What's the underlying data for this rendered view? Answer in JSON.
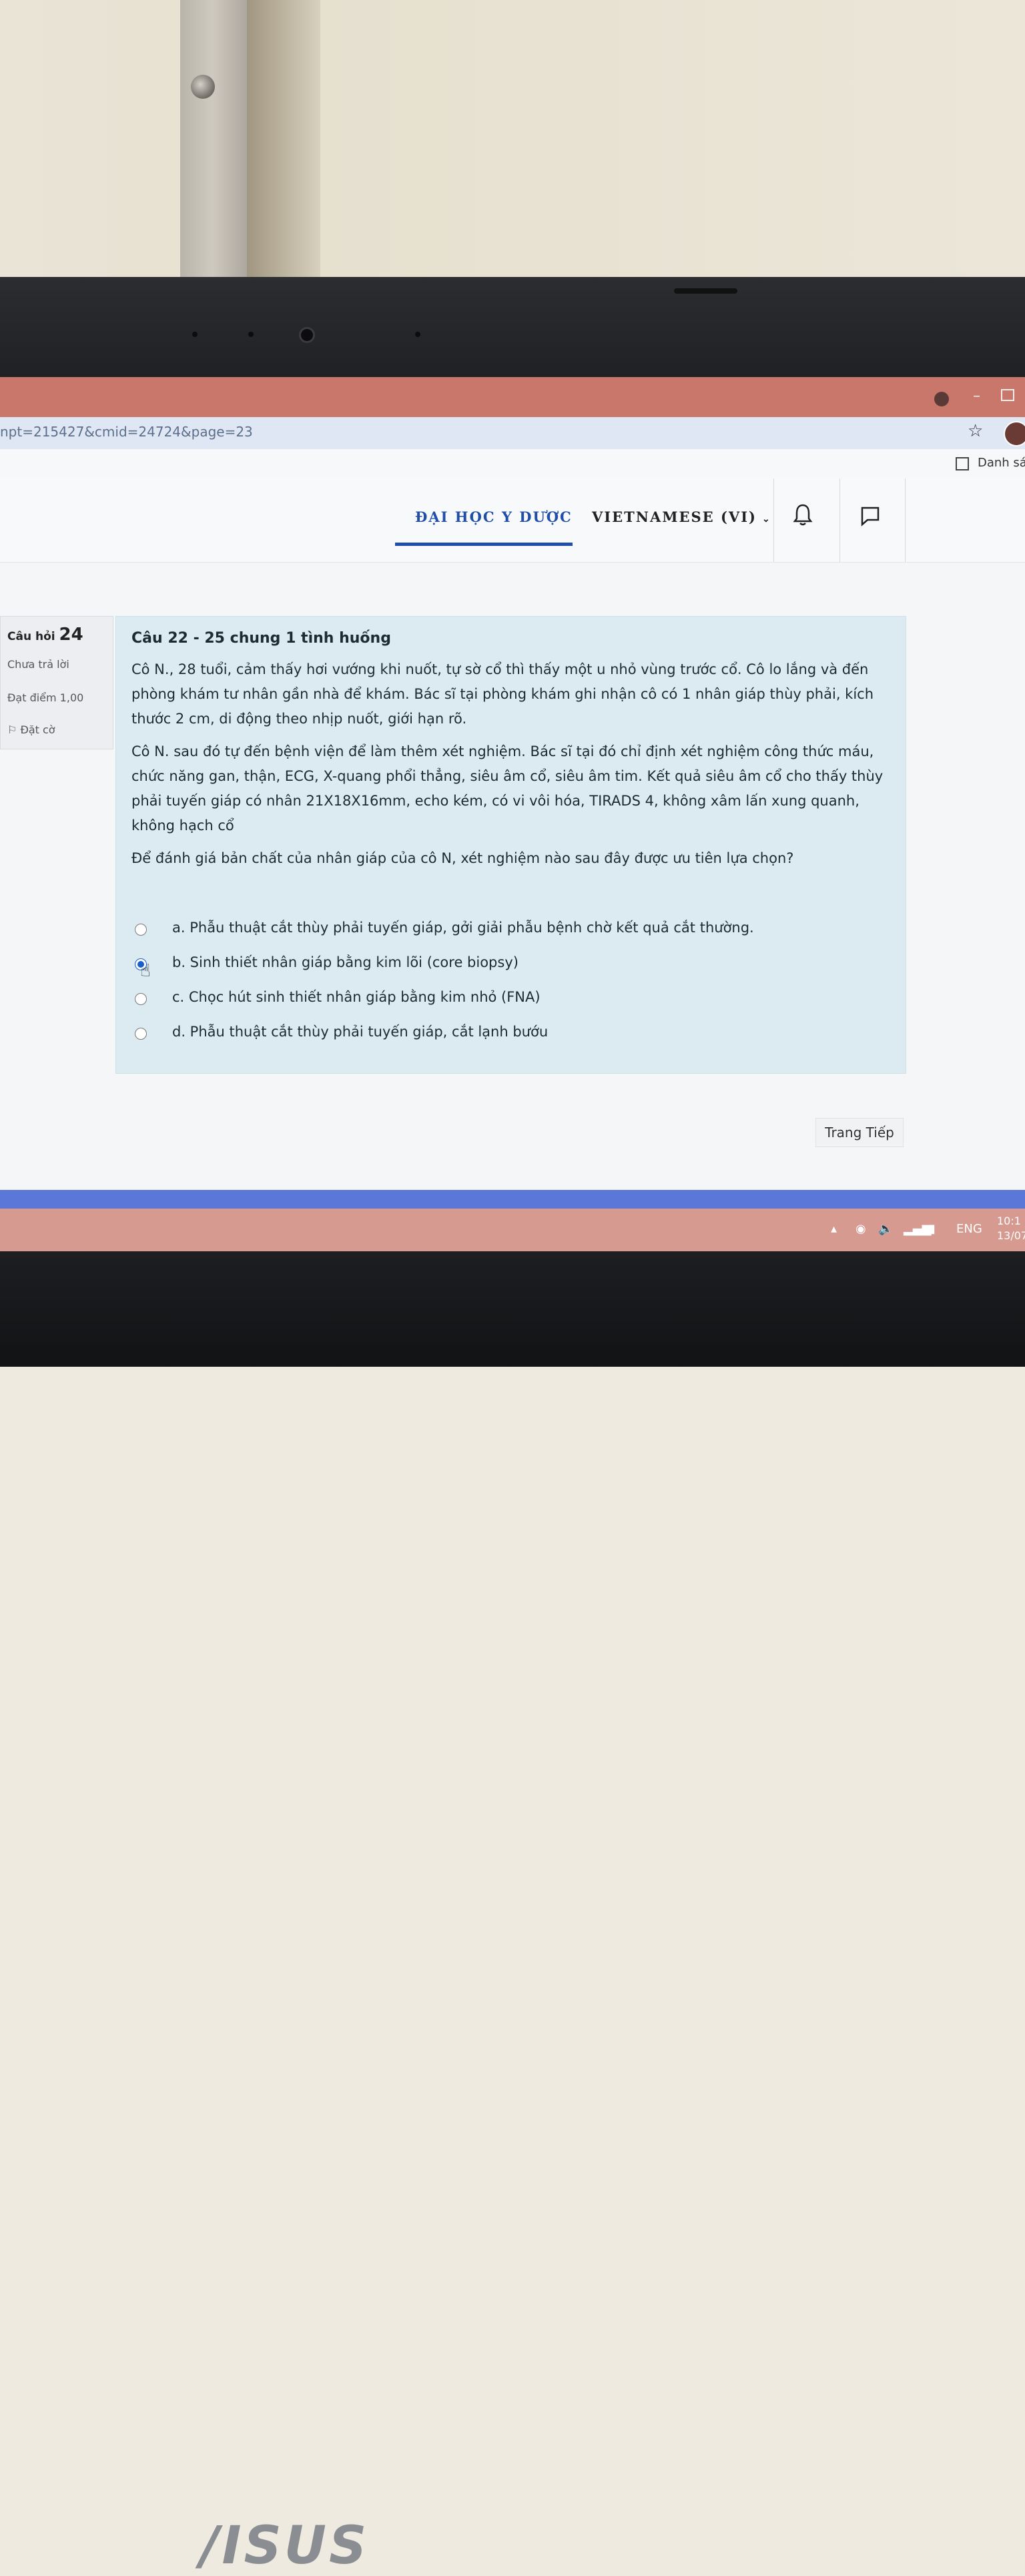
{
  "browser": {
    "url": "npt=215427&cmid=24724&page=23",
    "bookmark_label": "Danh sác"
  },
  "navbar": {
    "university": "ĐẠI HỌC Y DƯỢC",
    "language": "VIETNAMESE (VI)"
  },
  "question_info": {
    "label": "Câu hỏi",
    "number": "24",
    "status": "Chưa trả lời",
    "mark": "Đạt điểm 1,00",
    "flag": "Đặt cờ"
  },
  "question": {
    "heading": "Câu 22 - 25 chung 1 tình huống",
    "paragraph1": "Cô N., 28 tuổi, cảm thấy hơi vướng khi nuốt, tự sờ cổ thì thấy một u nhỏ vùng trước cổ. Cô lo lắng và đến phòng khám tư nhân gần nhà để khám. Bác sĩ tại phòng khám ghi nhận cô có 1 nhân giáp thùy phải, kích thước 2 cm, di động theo nhịp nuốt, giới hạn rõ.",
    "paragraph2": "Cô N. sau đó tự đến bệnh viện để làm thêm xét nghiệm. Bác sĩ tại đó chỉ định xét nghiệm công thức máu, chức năng gan, thận, ECG, X-quang phổi thẳng, siêu âm cổ, siêu âm tim. Kết quả siêu âm cổ cho thấy thùy phải tuyến giáp có nhân 21X18X16mm, echo kém, có vi vôi hóa, TIRADS 4, không xâm lấn xung quanh, không hạch cổ",
    "prompt": "Để đánh giá bản chất của nhân giáp của cô N, xét nghiệm nào sau đây được ưu tiên lựa chọn?",
    "answers": [
      {
        "label": "a. Phẫu thuật cắt thùy phải tuyến giáp, gởi giải phẫu bệnh chờ kết quả cắt thường.",
        "selected": false
      },
      {
        "label": "b. Sinh thiết nhân giáp bằng kim lõi (core biopsy)",
        "selected": true
      },
      {
        "label": "c. Chọc hút sinh thiết nhân giáp bằng kim nhỏ (FNA)",
        "selected": false
      },
      {
        "label": "d. Phẫu thuật cắt thùy phải tuyến giáp, cắt lạnh bướu",
        "selected": false
      }
    ]
  },
  "next_button": "Trang Tiếp",
  "taskbar": {
    "language": "ENG",
    "time": "10:1",
    "date": "13/07"
  },
  "laptop_brand": "/ISUS"
}
